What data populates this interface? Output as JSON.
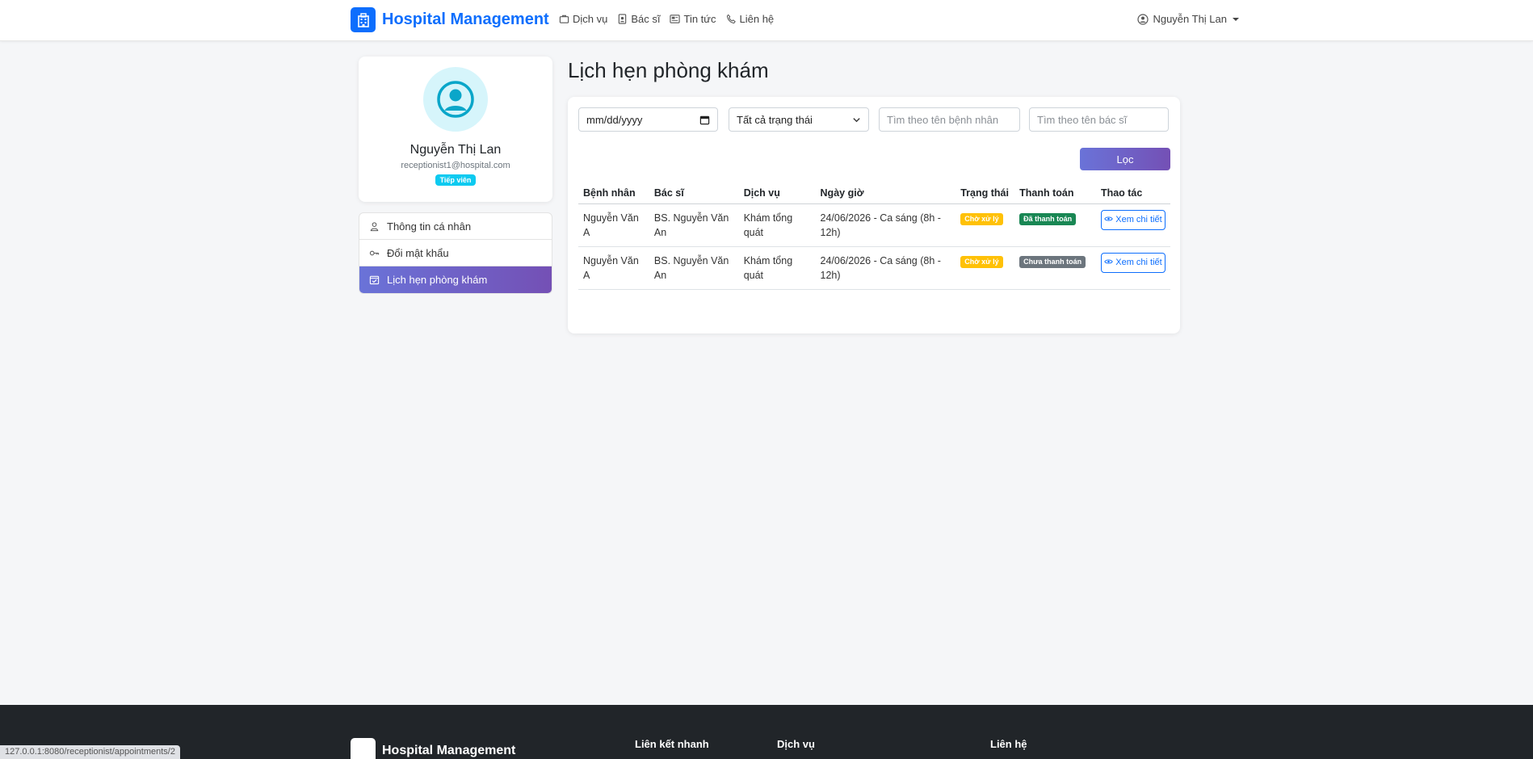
{
  "nav": {
    "brand": "Hospital Management",
    "links": [
      "Dịch vụ",
      "Bác sĩ",
      "Tin tức",
      "Liên hệ"
    ],
    "user": "Nguyễn Thị Lan"
  },
  "profile": {
    "name": "Nguyễn Thị Lan",
    "email": "receptionist1@hospital.com",
    "role": "Tiếp viên"
  },
  "sidebar": {
    "items": [
      {
        "label": "Thông tin cá nhân",
        "icon": "person-icon",
        "active": false
      },
      {
        "label": "Đổi mật khẩu",
        "icon": "key-icon",
        "active": false
      },
      {
        "label": "Lịch hẹn phòng khám",
        "icon": "calendar-check-icon",
        "active": true
      }
    ]
  },
  "main": {
    "title": "Lịch hẹn phòng khám",
    "filters": {
      "date_placeholder": "mm/dd/yyyy",
      "status_selected": "Tất cả trạng thái",
      "patient_placeholder": "Tìm theo tên bệnh nhân",
      "doctor_placeholder": "Tìm theo tên bác sĩ",
      "filter_button": "Lọc"
    },
    "table": {
      "headers": [
        "Bệnh nhân",
        "Bác sĩ",
        "Dịch vụ",
        "Ngày giờ",
        "Trạng thái",
        "Thanh toán",
        "Thao tác"
      ],
      "rows": [
        {
          "patient": "Nguyễn Văn A",
          "doctor": "BS. Nguyễn Văn An",
          "service": "Khám tổng quát",
          "datetime": "24/06/2026 - Ca sáng (8h - 12h)",
          "status": "Chờ xử lý",
          "payment": "Đã thanh toán",
          "payment_type": "paid",
          "action": "Xem chi tiết"
        },
        {
          "patient": "Nguyễn Văn A",
          "doctor": "BS. Nguyễn Văn An",
          "service": "Khám tổng quát",
          "datetime": "24/06/2026 - Ca sáng (8h - 12h)",
          "status": "Chờ xử lý",
          "payment": "Chưa thanh toán",
          "payment_type": "unpaid",
          "action": "Xem chi tiết"
        }
      ]
    }
  },
  "footer": {
    "brand": "Hospital Management",
    "columns": [
      "Liên kết nhanh",
      "Dịch vụ",
      "Liên hệ"
    ]
  },
  "status_bar": "127.0.0.1:8080/receptionist/appointments/2",
  "colors": {
    "primary": "#0d6efd",
    "accent_gradient_start": "#6a73d8",
    "accent_gradient_end": "#7450b5",
    "warning": "#ffc107",
    "success": "#198754",
    "secondary": "#6c757d",
    "info": "#0dcaf0"
  }
}
